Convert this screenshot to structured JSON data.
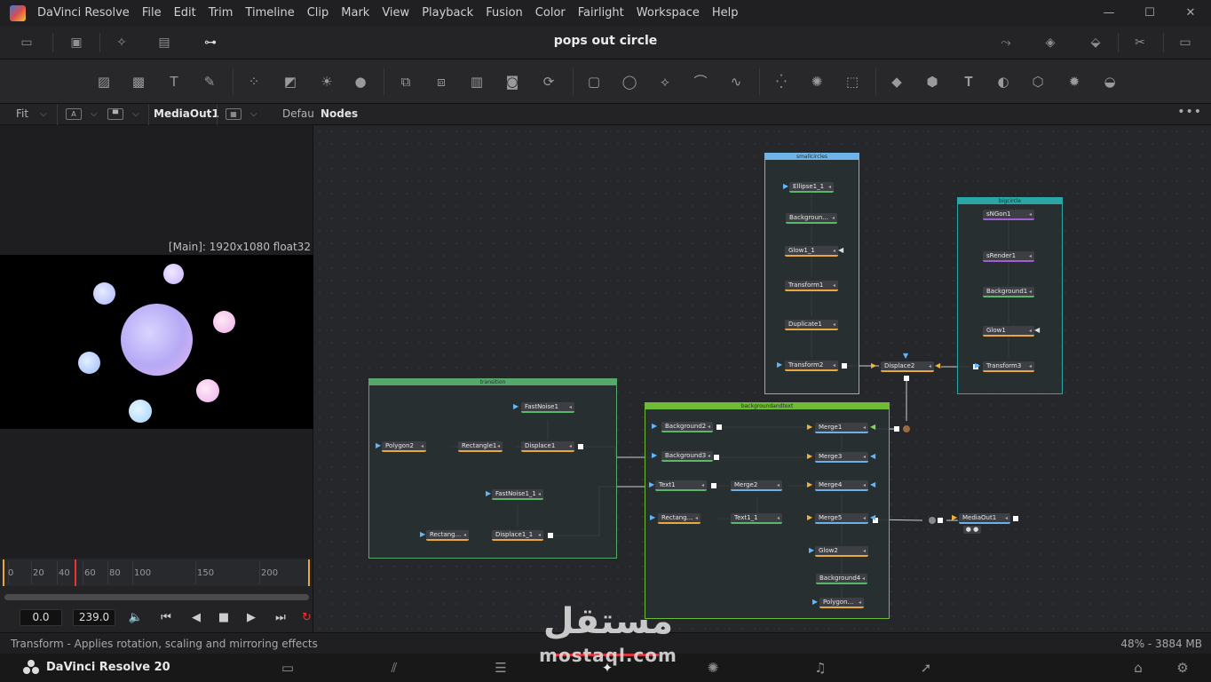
{
  "menubar": {
    "app_name": "DaVinci Resolve",
    "items": [
      "File",
      "Edit",
      "Trim",
      "Timeline",
      "Clip",
      "Mark",
      "View",
      "Playback",
      "Fusion",
      "Color",
      "Fairlight",
      "Workspace",
      "Help"
    ],
    "window_controls": {
      "minimize": "—",
      "maximize": "☐",
      "close": "✕"
    }
  },
  "toolbar": {
    "project_title": "pops out circle"
  },
  "viewer": {
    "fit_label": "Fit",
    "node_label": "MediaOut1",
    "lut_label": "Defau",
    "info": "[Main]: 1920x1080 float32"
  },
  "nodes_panel": {
    "title": "Nodes",
    "more": "•••",
    "groups": [
      {
        "id": "g-transition",
        "name": "transition",
        "color": "#56a86b"
      },
      {
        "id": "g-smallcircles",
        "name": "smallcircles",
        "color": "#6fb4e8"
      },
      {
        "id": "g-bigcircle",
        "name": "bigcircle",
        "color": "#2aa6a6"
      },
      {
        "id": "g-background",
        "name": "backgroundandtext",
        "color": "#6fbb33"
      }
    ],
    "nodes": {
      "ellipse1_1": "Ellipse1_1",
      "background_sc": "Backgroun...",
      "glow1_1": "Glow1_1",
      "transform1": "Transform1",
      "duplicate1": "Duplicate1",
      "transform2": "Transform2",
      "sngon1": "sNGon1",
      "srender1": "sRender1",
      "background1": "Background1",
      "glow1": "Glow1",
      "transform3": "Transform3",
      "displace2": "Displace2",
      "fastnoise1": "FastNoise1",
      "polygon2": "Polygon2",
      "rectangle1": "Rectangle1",
      "displace1": "Displace1",
      "fastnoise1_1": "FastNoise1_1",
      "rectang_a": "Rectang...",
      "displace1_1": "Displace1_1",
      "background2": "Background2",
      "background3": "Background3",
      "text1": "Text1",
      "rectang_b": "Rectang...",
      "merge1": "Merge1",
      "merge3": "Merge3",
      "merge2": "Merge2",
      "merge4": "Merge4",
      "text1_1": "Text1_1",
      "merge5": "Merge5",
      "glow2": "Glow2",
      "background4": "Background4",
      "polygon": "Polygon...",
      "mediaout1": "MediaOut1"
    }
  },
  "timeline": {
    "ticks": [
      "0",
      "20",
      "40",
      "60",
      "80",
      "100",
      "150",
      "200"
    ],
    "start_time": "0.0",
    "end_time": "239.0"
  },
  "status": {
    "text": "Transform - Applies rotation, scaling and mirroring effects",
    "memory": "48% - 3884 MB"
  },
  "pagebar": {
    "brand": "DaVinci Resolve 20"
  },
  "watermark": {
    "arabic": "مستقل",
    "latin": "mostaql.com"
  },
  "colors": {
    "accent_red": "#d8333b",
    "merge_orange": "#e8a83a",
    "fusion_green": "#59b76a"
  }
}
